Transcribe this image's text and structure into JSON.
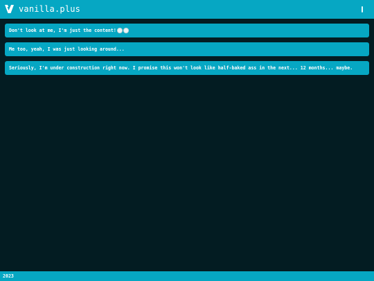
{
  "header": {
    "brand": "vanilla.plus",
    "logo_icon": "vanilla-v-logo-icon",
    "menu_icon": "menu-icon"
  },
  "cards": [
    {
      "text": "Don't look at me, I'm just the content!",
      "emoji": "eyes-emoji"
    },
    {
      "text": "Me too, yeah, I was just looking around..."
    },
    {
      "text": "Seriously, I'm under construction right now. I promise this won't look like half-baked ass in the next... 12 months... maybe."
    }
  ],
  "footer": {
    "year": "2023"
  },
  "colors": {
    "accent": "#06a7c3",
    "background": "#031c22",
    "text": "#ffffff"
  }
}
